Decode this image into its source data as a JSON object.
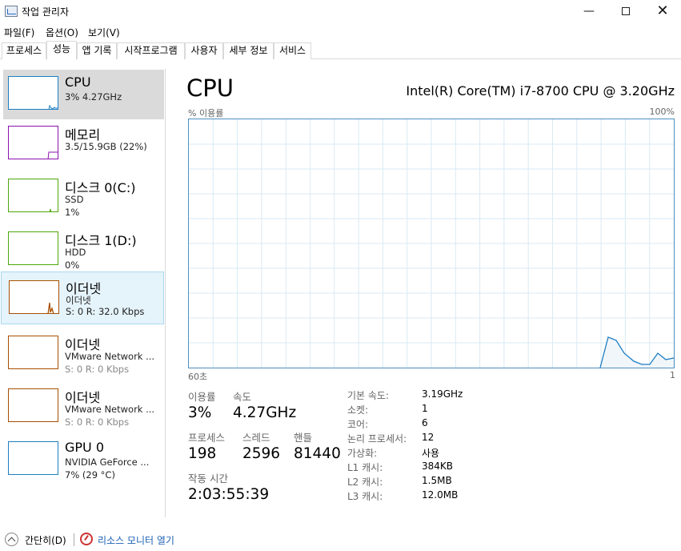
{
  "app": {
    "title": "작업 관리자"
  },
  "menu": [
    "파일(F)",
    "옵션(O)",
    "보기(V)"
  ],
  "tabs": [
    "프로세스",
    "성능",
    "앱 기록",
    "시작프로그램",
    "사용자",
    "세부 정보",
    "서비스"
  ],
  "active_tab": "성능",
  "sidebar": {
    "items": [
      {
        "name": "CPU",
        "sub1": "3% 4.27GHz",
        "sub2": "",
        "color": "#1c7ec4"
      },
      {
        "name": "메모리",
        "sub1": "3.5/15.9GB (22%)",
        "sub2": "",
        "color": "#8b12ae"
      },
      {
        "name": "디스크 0(C:)",
        "sub1": "SSD",
        "sub2": "1%",
        "color": "#4da60c"
      },
      {
        "name": "디스크 1(D:)",
        "sub1": "HDD",
        "sub2": "0%",
        "color": "#4da60c"
      },
      {
        "name": "이더넷",
        "sub1": "이더넷",
        "sub2": "S: 0 R: 32.0 Kbps",
        "color": "#a74f01"
      },
      {
        "name": "이더넷",
        "sub1": "VMware Network ...",
        "sub2": "S: 0 R: 0 Kbps",
        "color": "#a74f01"
      },
      {
        "name": "이더넷",
        "sub1": "VMware Network ...",
        "sub2": "S: 0 R: 0 Kbps",
        "color": "#a74f01"
      },
      {
        "name": "GPU 0",
        "sub1": "NVIDIA GeForce ...",
        "sub2": "7% (29 °C)",
        "color": "#1c7ec4"
      }
    ]
  },
  "main": {
    "title": "CPU",
    "model": "Intel(R) Core(TM) i7-8700 CPU @ 3.20GHz",
    "graph": {
      "ylabel": "% 이용률",
      "ymax_label": "100%",
      "x_left_label": "60초",
      "x_right_label": "1",
      "line_color": "#1c7ec4",
      "fill_color": "#f1f6fa",
      "grid_color": "#d9eaf4"
    },
    "stats": {
      "utilization_label": "이용률",
      "utilization_value": "3%",
      "speed_label": "속도",
      "speed_value": "4.27GHz",
      "processes_label": "프로세스",
      "processes_value": "198",
      "threads_label": "스레드",
      "threads_value": "2596",
      "handles_label": "핸들",
      "handles_value": "81440",
      "uptime_label": "작동 시간",
      "uptime_value": "2:03:55:39"
    },
    "info": [
      {
        "label": "기본 속도:",
        "value": "3.19GHz"
      },
      {
        "label": "소켓:",
        "value": "1"
      },
      {
        "label": "코어:",
        "value": "6"
      },
      {
        "label": "논리 프로세서:",
        "value": "12"
      },
      {
        "label": "가상화:",
        "value": "사용"
      },
      {
        "label": "L1 캐시:",
        "value": "384KB"
      },
      {
        "label": "L2 캐시:",
        "value": "1.5MB"
      },
      {
        "label": "L3 캐시:",
        "value": "12.0MB"
      }
    ]
  },
  "footer": {
    "collapse_label": "간단히(D)",
    "monitor_label": "리소스 모니터 열기"
  }
}
